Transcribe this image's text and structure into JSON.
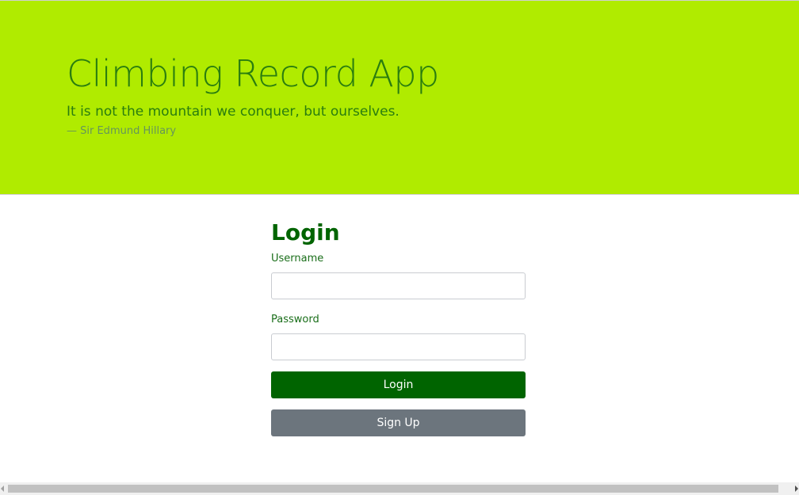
{
  "hero": {
    "title": "Climbing Record App",
    "quote": "It is not the mountain we conquer, but ourselves.",
    "author": "— Sir Edmund Hillary"
  },
  "login": {
    "heading": "Login",
    "username_label": "Username",
    "username_value": "",
    "password_label": "Password",
    "password_value": "",
    "login_button": "Login",
    "signup_button": "Sign Up"
  },
  "colors": {
    "hero_background": "#b0eb00",
    "primary_green": "#006400",
    "secondary_gray": "#6c757d"
  }
}
